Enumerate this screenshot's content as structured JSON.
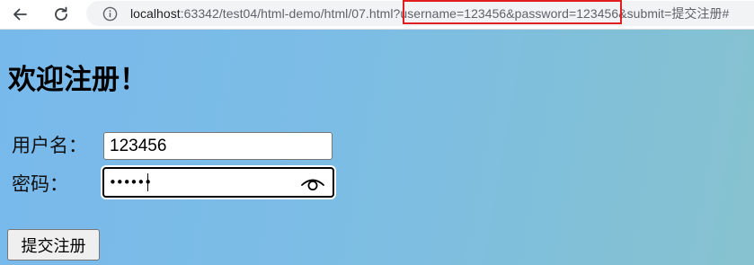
{
  "browser": {
    "url_host": "localhost",
    "url_rest": ":63342/test04/html-demo/html/07.html?username=123456&password=123456&submit=提交注册#",
    "icons": {
      "back": "arrow-left-icon",
      "reload": "reload-icon",
      "info": "info-icon"
    },
    "highlight_color": "#e02020"
  },
  "page": {
    "title": "欢迎注册！",
    "form": {
      "username_label": "用户名：",
      "username_value": "123456",
      "password_label": "密码：",
      "password_mask": "••••••",
      "submit_label": "提交注册"
    },
    "background_colors": [
      "#78b9ec",
      "#86c2cf"
    ]
  }
}
